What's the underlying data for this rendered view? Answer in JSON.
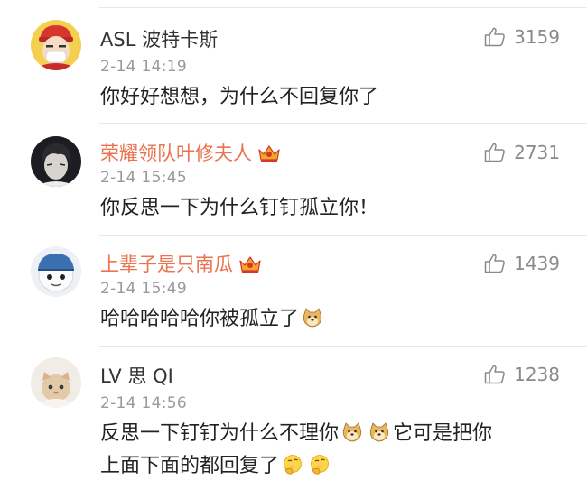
{
  "comments": [
    {
      "username": "ASL 波特卡斯",
      "vip": false,
      "time": "2-14 14:19",
      "likes": "3159",
      "text_parts": [
        "你好好想想，为什么不回复你了"
      ]
    },
    {
      "username": "荣耀领队叶修夫人",
      "vip": true,
      "time": "2-14 15:45",
      "likes": "2731",
      "text_parts": [
        "你反思一下为什么钉钉孤立你！"
      ]
    },
    {
      "username": "上辈子是只南瓜",
      "vip": true,
      "time": "2-14 15:49",
      "likes": "1439",
      "text_parts": [
        "哈哈哈哈哈你被孤立了"
      ]
    },
    {
      "username": "LV 思 QI",
      "vip": false,
      "time": "2-14 14:56",
      "likes": "1238",
      "text_parts": [
        "反思一下钉钉为什么不理你",
        "它可是把你",
        "上面下面的都回复了"
      ]
    }
  ],
  "icons": {
    "like": "thumbs-up-icon",
    "vip": "crown-vip-badge-icon",
    "doge": "doge-emoji-icon",
    "thinking": "thinking-emoji-icon"
  },
  "colors": {
    "vip_name": "#eb7350",
    "time": "#9a9a9a",
    "like": "#8a8a8a",
    "divider": "#e8e8e8"
  }
}
